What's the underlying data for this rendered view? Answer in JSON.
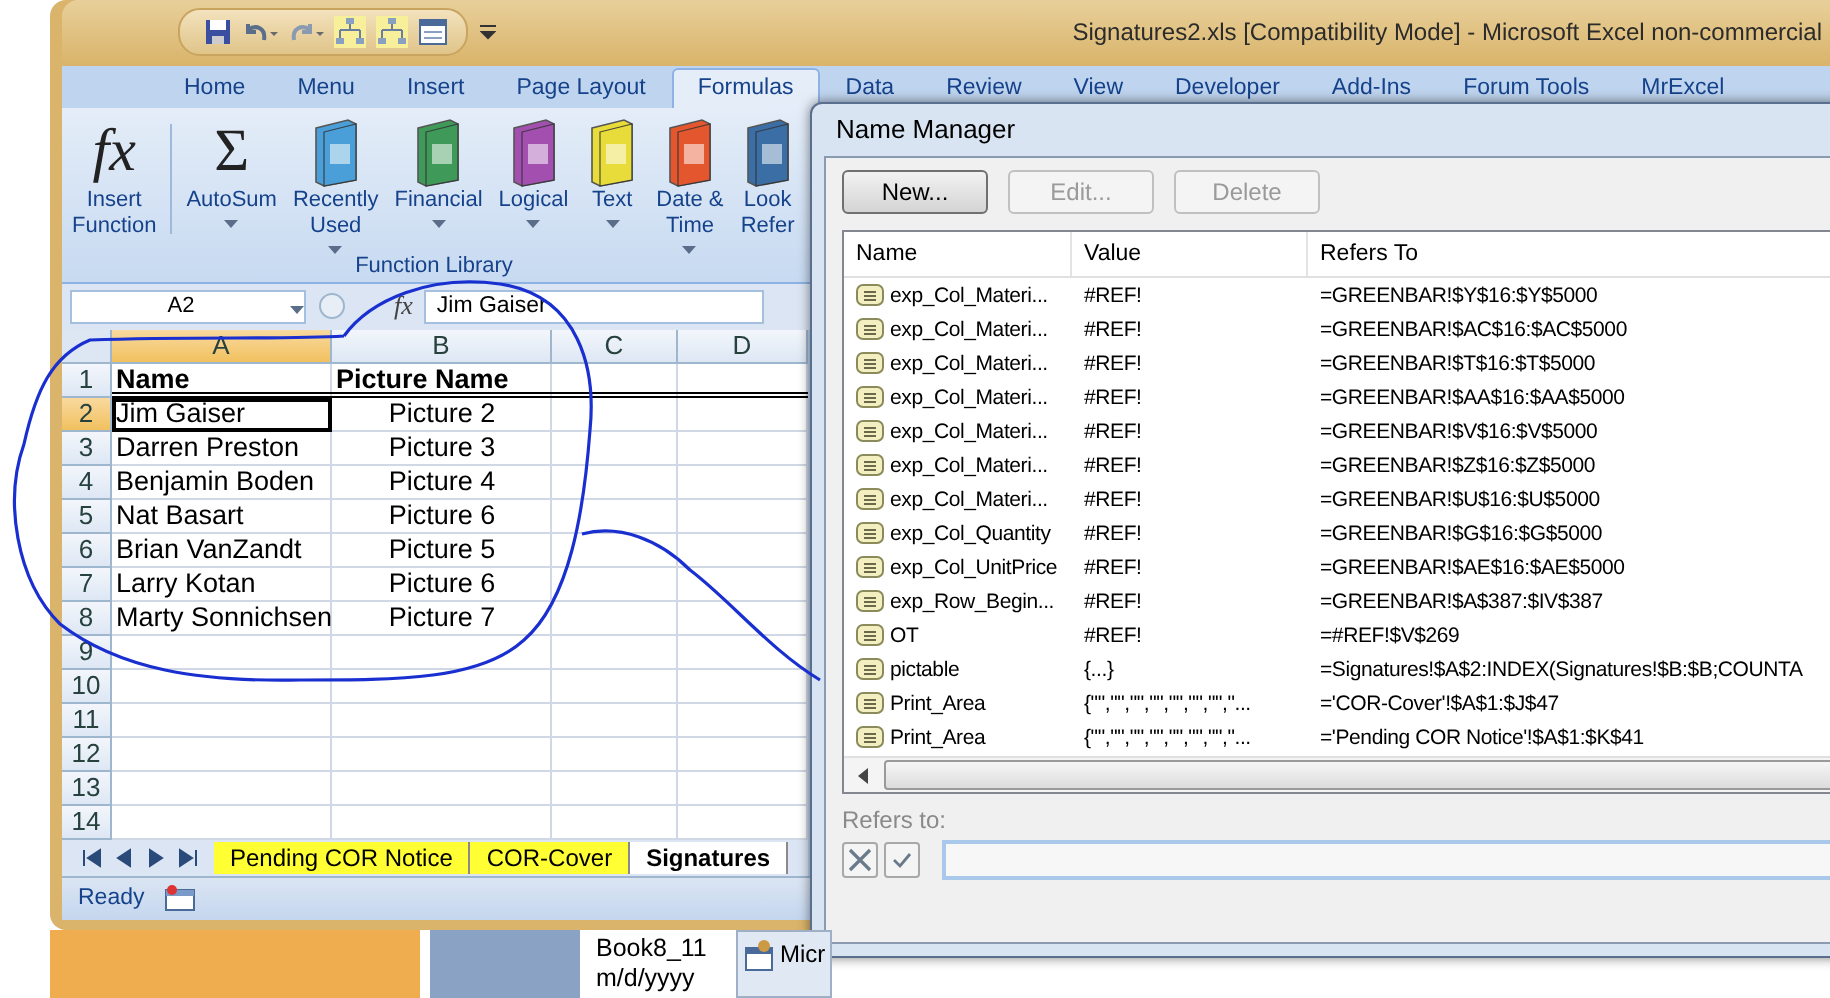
{
  "window": {
    "title": "Signatures2.xls  [Compatibility Mode] - Microsoft Excel non-commercial"
  },
  "ribbon_tabs": [
    {
      "label": "Home",
      "selected": false
    },
    {
      "label": "Menu",
      "selected": false
    },
    {
      "label": "Insert",
      "selected": false
    },
    {
      "label": "Page Layout",
      "selected": false
    },
    {
      "label": "Formulas",
      "selected": true
    },
    {
      "label": "Data",
      "selected": false
    },
    {
      "label": "Review",
      "selected": false
    },
    {
      "label": "View",
      "selected": false
    },
    {
      "label": "Developer",
      "selected": false
    },
    {
      "label": "Add-Ins",
      "selected": false
    },
    {
      "label": "Forum Tools",
      "selected": false
    },
    {
      "label": "MrExcel",
      "selected": false
    }
  ],
  "ribbon_buttons": [
    {
      "kind": "glyph",
      "glyph": "fx",
      "lines": [
        "Insert",
        "Function"
      ],
      "dropdown": false
    },
    {
      "kind": "glyph",
      "glyph": "Σ",
      "lines": [
        "AutoSum"
      ],
      "dropdown": true
    },
    {
      "kind": "book",
      "color": "#4a9fd8",
      "lines": [
        "Recently",
        "Used"
      ],
      "dropdown": true
    },
    {
      "kind": "book",
      "color": "#3f9a5a",
      "lines": [
        "Financial"
      ],
      "dropdown": true
    },
    {
      "kind": "book",
      "color": "#a24fb0",
      "lines": [
        "Logical"
      ],
      "dropdown": true
    },
    {
      "kind": "book",
      "color": "#e8dc3a",
      "lines": [
        "Text"
      ],
      "dropdown": true
    },
    {
      "kind": "book",
      "color": "#e4572e",
      "lines": [
        "Date &",
        "Time"
      ],
      "dropdown": true
    },
    {
      "kind": "book",
      "color": "#3a6ea5",
      "lines": [
        "Look",
        "Refer"
      ],
      "dropdown": false
    }
  ],
  "ribbon_group": "Function Library",
  "formula_bar": {
    "name_box": "A2",
    "fx": "fx",
    "value": "Jim Gaiser"
  },
  "sheet": {
    "columns": [
      {
        "label": "A",
        "selected": true
      },
      {
        "label": "B",
        "selected": false
      },
      {
        "label": "C",
        "selected": false
      },
      {
        "label": "D",
        "selected": false
      }
    ],
    "rows": [
      {
        "number": "1",
        "selected": false,
        "kind": "header",
        "cells": [
          "Name",
          "Picture Name"
        ]
      },
      {
        "number": "2",
        "selected": true,
        "kind": "data",
        "cells": [
          "Jim Gaiser",
          "Picture 2"
        ]
      },
      {
        "number": "3",
        "selected": false,
        "kind": "data",
        "cells": [
          "Darren Preston",
          "Picture 3"
        ]
      },
      {
        "number": "4",
        "selected": false,
        "kind": "data",
        "cells": [
          "Benjamin Boden",
          "Picture 4"
        ]
      },
      {
        "number": "5",
        "selected": false,
        "kind": "data",
        "cells": [
          "Nat Basart",
          "Picture 6"
        ]
      },
      {
        "number": "6",
        "selected": false,
        "kind": "data",
        "cells": [
          "Brian VanZandt",
          "Picture 5"
        ]
      },
      {
        "number": "7",
        "selected": false,
        "kind": "data",
        "cells": [
          "Larry Kotan",
          "Picture 6"
        ]
      },
      {
        "number": "8",
        "selected": false,
        "kind": "data",
        "cells": [
          "Marty Sonnichsen",
          "Picture 7"
        ]
      },
      {
        "number": "9",
        "selected": false,
        "kind": "data"
      },
      {
        "number": "10",
        "selected": false,
        "kind": "data"
      },
      {
        "number": "11",
        "selected": false,
        "kind": "data"
      },
      {
        "number": "12",
        "selected": false,
        "kind": "data"
      },
      {
        "number": "13",
        "selected": false,
        "kind": "data"
      },
      {
        "number": "14",
        "selected": false,
        "kind": "data"
      }
    ]
  },
  "sheet_tabs": [
    {
      "label": "Pending COR Notice",
      "selected": false
    },
    {
      "label": "COR-Cover",
      "selected": false
    },
    {
      "label": "Signatures",
      "selected": true
    }
  ],
  "status_bar": {
    "text": "Ready"
  },
  "dialog": {
    "title": "Name Manager",
    "buttons": [
      {
        "label": "New...",
        "disabled": false
      },
      {
        "label": "Edit...",
        "disabled": true
      },
      {
        "label": "Delete",
        "disabled": true
      }
    ],
    "columns": [
      "Name",
      "Value",
      "Refers To"
    ],
    "rows": [
      {
        "name": "exp_Col_Materi...",
        "value": "#REF!",
        "refers_to": "=GREENBAR!$Y$16:$Y$5000"
      },
      {
        "name": "exp_Col_Materi...",
        "value": "#REF!",
        "refers_to": "=GREENBAR!$AC$16:$AC$5000"
      },
      {
        "name": "exp_Col_Materi...",
        "value": "#REF!",
        "refers_to": "=GREENBAR!$T$16:$T$5000"
      },
      {
        "name": "exp_Col_Materi...",
        "value": "#REF!",
        "refers_to": "=GREENBAR!$AA$16:$AA$5000"
      },
      {
        "name": "exp_Col_Materi...",
        "value": "#REF!",
        "refers_to": "=GREENBAR!$V$16:$V$5000"
      },
      {
        "name": "exp_Col_Materi...",
        "value": "#REF!",
        "refers_to": "=GREENBAR!$Z$16:$Z$5000"
      },
      {
        "name": "exp_Col_Materi...",
        "value": "#REF!",
        "refers_to": "=GREENBAR!$U$16:$U$5000"
      },
      {
        "name": "exp_Col_Quantity",
        "value": "#REF!",
        "refers_to": "=GREENBAR!$G$16:$G$5000"
      },
      {
        "name": "exp_Col_UnitPrice",
        "value": "#REF!",
        "refers_to": "=GREENBAR!$AE$16:$AE$5000"
      },
      {
        "name": "exp_Row_Begin...",
        "value": "#REF!",
        "refers_to": "=GREENBAR!$A$387:$IV$387"
      },
      {
        "name": "OT",
        "value": "#REF!",
        "refers_to": "=#REF!$V$269"
      },
      {
        "name": "pictable",
        "value": "{...}",
        "refers_to": "=Signatures!$A$2:INDEX(Signatures!$B:$B;COUNTA"
      },
      {
        "name": "Print_Area",
        "value": "{\"\",\"\",\"\",\"\",\"\",\"\",\"\",\"...",
        "refers_to": "='COR-Cover'!$A$1:$J$47"
      },
      {
        "name": "Print_Area",
        "value": "{\"\",\"\",\"\",\"\",\"\",\"\",\"\",\"...",
        "refers_to": "='Pending COR Notice'!$A$1:$K$41"
      }
    ],
    "refers_to_label": "Refers to:"
  },
  "taskbar": {
    "file_lines": [
      "Book8_11",
      "m/d/yyyy"
    ],
    "button": "Micr"
  }
}
